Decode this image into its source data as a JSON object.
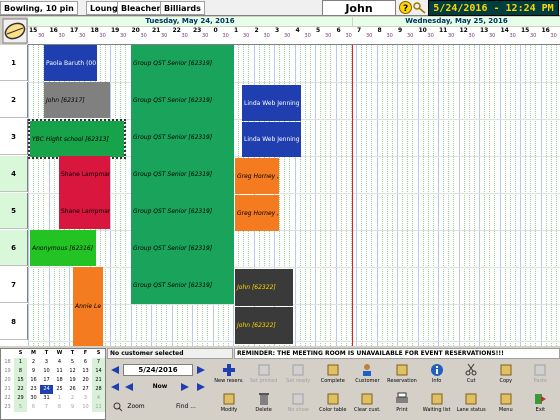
{
  "tabs": [
    {
      "label": "Bowling, 10 pin"
    },
    {
      "label": "Lounge"
    },
    {
      "label": "Bleachers"
    },
    {
      "label": "Billiards"
    }
  ],
  "user": {
    "name": "John"
  },
  "clock": {
    "text": "5/24/2016 - 12:24 PM"
  },
  "dates": {
    "day1": "Tuesday, May 24, 2016",
    "day2": "Wednesday, May 25, 2016"
  },
  "ruler": {
    "labels": [
      "15",
      "16",
      "17",
      "18",
      "19",
      "20",
      "21",
      "22",
      "23",
      "0",
      "1",
      "2",
      "3",
      "4",
      "5",
      "6",
      "7",
      "8",
      "9",
      "10",
      "11",
      "12",
      "13",
      "14",
      "15",
      "16"
    ],
    "minor": [
      "30",
      "30",
      "30",
      "30",
      "30",
      "30",
      "30",
      "30",
      "30",
      "30",
      "30",
      "30",
      "30",
      "30",
      "30",
      "30",
      "30",
      "30",
      "30",
      "30",
      "30",
      "30",
      "30",
      "30",
      "30",
      "30"
    ]
  },
  "lanes": [
    "1",
    "2",
    "3",
    "4",
    "5",
    "6",
    "7",
    "8"
  ],
  "bookings": [
    {
      "id": "b1",
      "label": "Paola Baruth (00",
      "color": "#1f3fb0",
      "text": "#ffffff"
    },
    {
      "id": "b2",
      "label": "John [62317]",
      "color": "#808080",
      "text": "#000000"
    },
    {
      "id": "b3",
      "label": "YBC Hight school [62313]",
      "color": "#16a34a",
      "text": "#000000"
    },
    {
      "id": "b4",
      "label": "Shane Lampman",
      "color": "#d9163e",
      "text": "#000000"
    },
    {
      "id": "b5",
      "label": "Shane Lampman",
      "color": "#d9163e",
      "text": "#000000"
    },
    {
      "id": "b6",
      "label": "Anonymous [62316]",
      "color": "#22c322",
      "text": "#000000"
    },
    {
      "id": "b7",
      "label": "Annie Le",
      "color": "#f47b20",
      "text": "#000000"
    },
    {
      "id": "b8",
      "label": "Group QST Senior [62319]",
      "color": "#1aa35a",
      "text": "#000000"
    },
    {
      "id": "b9",
      "label": "Group QST Senior [62319]",
      "color": "#1aa35a",
      "text": "#000000"
    },
    {
      "id": "b10",
      "label": "Group QST Senior [62319]",
      "color": "#1aa35a",
      "text": "#000000"
    },
    {
      "id": "b11",
      "label": "Group QST Senior [62319]",
      "color": "#1aa35a",
      "text": "#000000"
    },
    {
      "id": "b12",
      "label": "Group QST Senior [62319]",
      "color": "#1aa35a",
      "text": "#000000"
    },
    {
      "id": "b13",
      "label": "Group QST Senior [62319]",
      "color": "#1aa35a",
      "text": "#000000"
    },
    {
      "id": "b14",
      "label": "Group QST Senior [62319]",
      "color": "#1aa35a",
      "text": "#000000"
    },
    {
      "id": "b15",
      "label": "Linda Web Jenning",
      "color": "#1f3fb0",
      "text": "#ffffff"
    },
    {
      "id": "b16",
      "label": "Linda Web Jenning",
      "color": "#1f3fb0",
      "text": "#ffffff"
    },
    {
      "id": "b17",
      "label": "Greg Horney ,",
      "color": "#f47b20",
      "text": "#000000"
    },
    {
      "id": "b18",
      "label": "Greg Horney ,",
      "color": "#f47b20",
      "text": "#000000"
    },
    {
      "id": "b19",
      "label": "John [62322]",
      "color": "#3a3a3a",
      "text": "#ffd700"
    },
    {
      "id": "b20",
      "label": "John [62322]",
      "color": "#3a3a3a",
      "text": "#ffd700"
    }
  ],
  "calendar": {
    "weekdays": [
      "S",
      "M",
      "T",
      "W",
      "T",
      "F",
      "S"
    ],
    "weeks": [
      {
        "wk": "18",
        "days": [
          "1",
          "2",
          "3",
          "4",
          "5",
          "6",
          "7"
        ]
      },
      {
        "wk": "19",
        "days": [
          "8",
          "9",
          "10",
          "11",
          "12",
          "13",
          "14"
        ]
      },
      {
        "wk": "20",
        "days": [
          "15",
          "16",
          "17",
          "18",
          "19",
          "20",
          "21"
        ]
      },
      {
        "wk": "21",
        "days": [
          "22",
          "23",
          "24",
          "25",
          "26",
          "27",
          "28"
        ]
      },
      {
        "wk": "22",
        "days": [
          "29",
          "30",
          "31",
          "1",
          "2",
          "3",
          "4"
        ]
      },
      {
        "wk": "23",
        "days": [
          "5",
          "6",
          "7",
          "8",
          "9",
          "10",
          "11"
        ]
      }
    ],
    "selected": "24"
  },
  "status": {
    "customer": "No customer selected"
  },
  "reminder": {
    "text": "REMINDER:  THE MEETING ROOM IS UNAVAILABLE FOR EVENT RESERVATIONS!!!"
  },
  "nav": {
    "date": "5/24/2016",
    "now": "Now",
    "zoom": "Zoom",
    "find": "Find ..."
  },
  "toolbar": [
    {
      "label": "New reserv.",
      "enabled": true
    },
    {
      "label": "Set printed",
      "enabled": false
    },
    {
      "label": "Set ready",
      "enabled": false
    },
    {
      "label": "Complete",
      "enabled": true
    },
    {
      "label": "Customer",
      "enabled": true
    },
    {
      "label": "Reservation",
      "enabled": true
    },
    {
      "label": "Info",
      "enabled": true
    },
    {
      "label": "Cut",
      "enabled": true
    },
    {
      "label": "Copy",
      "enabled": true
    },
    {
      "label": "Paste",
      "enabled": false
    },
    {
      "label": "Modify",
      "enabled": true
    },
    {
      "label": "Delete",
      "enabled": true
    },
    {
      "label": "No show",
      "enabled": false
    },
    {
      "label": "Color table",
      "enabled": true
    },
    {
      "label": "Clear cust.",
      "enabled": true
    },
    {
      "label": "Print",
      "enabled": true
    },
    {
      "label": "Waiting list",
      "enabled": true
    },
    {
      "label": "Lane status",
      "enabled": true
    },
    {
      "label": "Menu",
      "enabled": true
    },
    {
      "label": "Exit",
      "enabled": true
    }
  ]
}
